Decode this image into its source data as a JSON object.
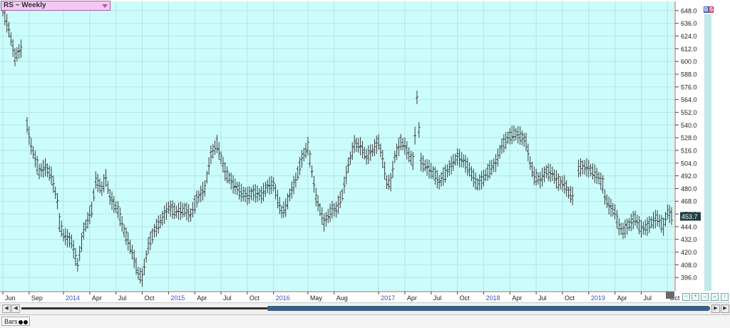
{
  "window": {
    "symbol_label": "RS ~ Weekly",
    "status_tab_label": "Bars",
    "badge_b": "B",
    "badge_s": "S"
  },
  "colors": {
    "plot_bg": "#ccfdfd",
    "grid": "#b6e3e3",
    "bars": "#3a3a3a",
    "axis_line": "#d05050",
    "last_price_bg": "#1e4046",
    "year_label": "#3553c8"
  },
  "chart_data": {
    "type": "bar",
    "style": "ohlc",
    "title": "",
    "xlabel": "",
    "ylabel": "",
    "ylim": [
      384,
      656
    ],
    "grid": true,
    "y_ticks": [
      648.0,
      636.0,
      624.0,
      612.0,
      600.0,
      588.0,
      576.0,
      564.0,
      552.0,
      540.0,
      528.0,
      516.0,
      504.0,
      492.0,
      480.0,
      468.0,
      456.0,
      444.0,
      432.0,
      420.0,
      408.0,
      396.0
    ],
    "y_tick_labels": [
      "648.0",
      "636.0",
      "624.0",
      "612.0",
      "600.0",
      "588.0",
      "576.0",
      "564.0",
      "552.0",
      "540.0",
      "528.0",
      "516.0",
      "504.0",
      "492.0",
      "480.0",
      "468.0",
      "456.0",
      "444.0",
      "432.0",
      "420.0",
      "408.0",
      "396.0"
    ],
    "x_ticks": [
      {
        "label": "Jun",
        "week": 0,
        "year": false
      },
      {
        "label": "Sep",
        "week": 13,
        "year": false
      },
      {
        "label": "2014",
        "week": 30,
        "year": true
      },
      {
        "label": "Apr",
        "week": 43,
        "year": false
      },
      {
        "label": "Jul",
        "week": 56,
        "year": false
      },
      {
        "label": "Oct",
        "week": 69,
        "year": false
      },
      {
        "label": "2015",
        "week": 82,
        "year": true
      },
      {
        "label": "Apr",
        "week": 95,
        "year": false
      },
      {
        "label": "Jul",
        "week": 108,
        "year": false
      },
      {
        "label": "Oct",
        "week": 121,
        "year": false
      },
      {
        "label": "2016",
        "week": 134,
        "year": true
      },
      {
        "label": "May",
        "week": 151,
        "year": false
      },
      {
        "label": "Aug",
        "week": 164,
        "year": false
      },
      {
        "label": "2017",
        "week": 186,
        "year": true
      },
      {
        "label": "Apr",
        "week": 199,
        "year": false
      },
      {
        "label": "Jul",
        "week": 212,
        "year": false
      },
      {
        "label": "Oct",
        "week": 225,
        "year": false
      },
      {
        "label": "2018",
        "week": 238,
        "year": true
      },
      {
        "label": "Apr",
        "week": 251,
        "year": false
      },
      {
        "label": "Jul",
        "week": 264,
        "year": false
      },
      {
        "label": "Oct",
        "week": 277,
        "year": false
      },
      {
        "label": "2019",
        "week": 290,
        "year": true
      },
      {
        "label": "Apr",
        "week": 303,
        "year": false
      },
      {
        "label": "Jul",
        "week": 316,
        "year": false
      },
      {
        "label": "Oct",
        "week": 329,
        "year": false
      }
    ],
    "last_price": 453.7,
    "last_price_label": "453.7",
    "week_count": 332,
    "anchors": [
      [
        0,
        648
      ],
      [
        3,
        630
      ],
      [
        6,
        604
      ],
      [
        9,
        612
      ],
      [
        12,
        540
      ],
      [
        14,
        520
      ],
      [
        16,
        508
      ],
      [
        18,
        496
      ],
      [
        21,
        500
      ],
      [
        24,
        492
      ],
      [
        27,
        468
      ],
      [
        28,
        448
      ],
      [
        30,
        436
      ],
      [
        34,
        430
      ],
      [
        37,
        408
      ],
      [
        40,
        440
      ],
      [
        44,
        460
      ],
      [
        46,
        488
      ],
      [
        49,
        480
      ],
      [
        51,
        490
      ],
      [
        53,
        472
      ],
      [
        55,
        465
      ],
      [
        57,
        460
      ],
      [
        60,
        440
      ],
      [
        64,
        420
      ],
      [
        67,
        400
      ],
      [
        69,
        396
      ],
      [
        72,
        426
      ],
      [
        75,
        440
      ],
      [
        79,
        452
      ],
      [
        82,
        462
      ],
      [
        86,
        458
      ],
      [
        90,
        460
      ],
      [
        93,
        455
      ],
      [
        96,
        470
      ],
      [
        100,
        480
      ],
      [
        103,
        512
      ],
      [
        106,
        522
      ],
      [
        110,
        496
      ],
      [
        114,
        484
      ],
      [
        118,
        476
      ],
      [
        121,
        473
      ],
      [
        124,
        476
      ],
      [
        128,
        474
      ],
      [
        131,
        482
      ],
      [
        134,
        484
      ],
      [
        136,
        470
      ],
      [
        138,
        458
      ],
      [
        140,
        462
      ],
      [
        142,
        474
      ],
      [
        145,
        488
      ],
      [
        148,
        508
      ],
      [
        151,
        520
      ],
      [
        153,
        496
      ],
      [
        155,
        472
      ],
      [
        157,
        460
      ],
      [
        159,
        448
      ],
      [
        161,
        454
      ],
      [
        163,
        460
      ],
      [
        165,
        460
      ],
      [
        168,
        474
      ],
      [
        171,
        502
      ],
      [
        174,
        522
      ],
      [
        177,
        520
      ],
      [
        180,
        510
      ],
      [
        183,
        516
      ],
      [
        186,
        524
      ],
      [
        188,
        508
      ],
      [
        190,
        486
      ],
      [
        192,
        486
      ],
      [
        194,
        510
      ],
      [
        197,
        524
      ],
      [
        199,
        520
      ],
      [
        201,
        512
      ],
      [
        203,
        506
      ],
      [
        204,
        530
      ],
      [
        205,
        566
      ],
      [
        207,
        505
      ],
      [
        210,
        500
      ],
      [
        213,
        495
      ],
      [
        216,
        486
      ],
      [
        219,
        494
      ],
      [
        222,
        502
      ],
      [
        225,
        510
      ],
      [
        228,
        506
      ],
      [
        231,
        498
      ],
      [
        233,
        490
      ],
      [
        235,
        484
      ],
      [
        238,
        490
      ],
      [
        241,
        498
      ],
      [
        244,
        504
      ],
      [
        247,
        520
      ],
      [
        250,
        528
      ],
      [
        253,
        532
      ],
      [
        256,
        530
      ],
      [
        259,
        524
      ],
      [
        261,
        504
      ],
      [
        263,
        492
      ],
      [
        266,
        488
      ],
      [
        269,
        496
      ],
      [
        272,
        494
      ],
      [
        275,
        486
      ],
      [
        278,
        484
      ],
      [
        280,
        476
      ],
      [
        282,
        473
      ],
      [
        283,
        472
      ],
      [
        284,
        498
      ],
      [
        286,
        500
      ],
      [
        289,
        500
      ],
      [
        292,
        496
      ],
      [
        295,
        490
      ],
      [
        297,
        484
      ],
      [
        298,
        472
      ],
      [
        300,
        464
      ],
      [
        303,
        458
      ],
      [
        305,
        444
      ],
      [
        307,
        440
      ],
      [
        310,
        446
      ],
      [
        313,
        452
      ],
      [
        316,
        442
      ],
      [
        319,
        444
      ],
      [
        322,
        450
      ],
      [
        324,
        452
      ],
      [
        327,
        444
      ],
      [
        329,
        458
      ],
      [
        331,
        454
      ]
    ],
    "gaps": [
      [
        10,
        11
      ],
      [
        283,
        284
      ]
    ]
  }
}
